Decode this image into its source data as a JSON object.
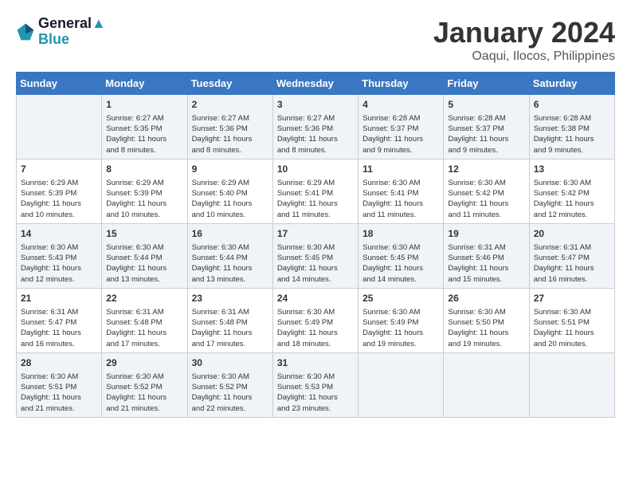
{
  "header": {
    "logo_line1": "General",
    "logo_line2": "Blue",
    "month": "January 2024",
    "location": "Oaqui, Ilocos, Philippines"
  },
  "days_of_week": [
    "Sunday",
    "Monday",
    "Tuesday",
    "Wednesday",
    "Thursday",
    "Friday",
    "Saturday"
  ],
  "weeks": [
    [
      {
        "day": "",
        "info": ""
      },
      {
        "day": "1",
        "info": "Sunrise: 6:27 AM\nSunset: 5:35 PM\nDaylight: 11 hours\nand 8 minutes."
      },
      {
        "day": "2",
        "info": "Sunrise: 6:27 AM\nSunset: 5:36 PM\nDaylight: 11 hours\nand 8 minutes."
      },
      {
        "day": "3",
        "info": "Sunrise: 6:27 AM\nSunset: 5:36 PM\nDaylight: 11 hours\nand 8 minutes."
      },
      {
        "day": "4",
        "info": "Sunrise: 6:28 AM\nSunset: 5:37 PM\nDaylight: 11 hours\nand 9 minutes."
      },
      {
        "day": "5",
        "info": "Sunrise: 6:28 AM\nSunset: 5:37 PM\nDaylight: 11 hours\nand 9 minutes."
      },
      {
        "day": "6",
        "info": "Sunrise: 6:28 AM\nSunset: 5:38 PM\nDaylight: 11 hours\nand 9 minutes."
      }
    ],
    [
      {
        "day": "7",
        "info": "Sunrise: 6:29 AM\nSunset: 5:39 PM\nDaylight: 11 hours\nand 10 minutes."
      },
      {
        "day": "8",
        "info": "Sunrise: 6:29 AM\nSunset: 5:39 PM\nDaylight: 11 hours\nand 10 minutes."
      },
      {
        "day": "9",
        "info": "Sunrise: 6:29 AM\nSunset: 5:40 PM\nDaylight: 11 hours\nand 10 minutes."
      },
      {
        "day": "10",
        "info": "Sunrise: 6:29 AM\nSunset: 5:41 PM\nDaylight: 11 hours\nand 11 minutes."
      },
      {
        "day": "11",
        "info": "Sunrise: 6:30 AM\nSunset: 5:41 PM\nDaylight: 11 hours\nand 11 minutes."
      },
      {
        "day": "12",
        "info": "Sunrise: 6:30 AM\nSunset: 5:42 PM\nDaylight: 11 hours\nand 11 minutes."
      },
      {
        "day": "13",
        "info": "Sunrise: 6:30 AM\nSunset: 5:42 PM\nDaylight: 11 hours\nand 12 minutes."
      }
    ],
    [
      {
        "day": "14",
        "info": "Sunrise: 6:30 AM\nSunset: 5:43 PM\nDaylight: 11 hours\nand 12 minutes."
      },
      {
        "day": "15",
        "info": "Sunrise: 6:30 AM\nSunset: 5:44 PM\nDaylight: 11 hours\nand 13 minutes."
      },
      {
        "day": "16",
        "info": "Sunrise: 6:30 AM\nSunset: 5:44 PM\nDaylight: 11 hours\nand 13 minutes."
      },
      {
        "day": "17",
        "info": "Sunrise: 6:30 AM\nSunset: 5:45 PM\nDaylight: 11 hours\nand 14 minutes."
      },
      {
        "day": "18",
        "info": "Sunrise: 6:30 AM\nSunset: 5:45 PM\nDaylight: 11 hours\nand 14 minutes."
      },
      {
        "day": "19",
        "info": "Sunrise: 6:31 AM\nSunset: 5:46 PM\nDaylight: 11 hours\nand 15 minutes."
      },
      {
        "day": "20",
        "info": "Sunrise: 6:31 AM\nSunset: 5:47 PM\nDaylight: 11 hours\nand 16 minutes."
      }
    ],
    [
      {
        "day": "21",
        "info": "Sunrise: 6:31 AM\nSunset: 5:47 PM\nDaylight: 11 hours\nand 16 minutes."
      },
      {
        "day": "22",
        "info": "Sunrise: 6:31 AM\nSunset: 5:48 PM\nDaylight: 11 hours\nand 17 minutes."
      },
      {
        "day": "23",
        "info": "Sunrise: 6:31 AM\nSunset: 5:48 PM\nDaylight: 11 hours\nand 17 minutes."
      },
      {
        "day": "24",
        "info": "Sunrise: 6:30 AM\nSunset: 5:49 PM\nDaylight: 11 hours\nand 18 minutes."
      },
      {
        "day": "25",
        "info": "Sunrise: 6:30 AM\nSunset: 5:49 PM\nDaylight: 11 hours\nand 19 minutes."
      },
      {
        "day": "26",
        "info": "Sunrise: 6:30 AM\nSunset: 5:50 PM\nDaylight: 11 hours\nand 19 minutes."
      },
      {
        "day": "27",
        "info": "Sunrise: 6:30 AM\nSunset: 5:51 PM\nDaylight: 11 hours\nand 20 minutes."
      }
    ],
    [
      {
        "day": "28",
        "info": "Sunrise: 6:30 AM\nSunset: 5:51 PM\nDaylight: 11 hours\nand 21 minutes."
      },
      {
        "day": "29",
        "info": "Sunrise: 6:30 AM\nSunset: 5:52 PM\nDaylight: 11 hours\nand 21 minutes."
      },
      {
        "day": "30",
        "info": "Sunrise: 6:30 AM\nSunset: 5:52 PM\nDaylight: 11 hours\nand 22 minutes."
      },
      {
        "day": "31",
        "info": "Sunrise: 6:30 AM\nSunset: 5:53 PM\nDaylight: 11 hours\nand 23 minutes."
      },
      {
        "day": "",
        "info": ""
      },
      {
        "day": "",
        "info": ""
      },
      {
        "day": "",
        "info": ""
      }
    ]
  ]
}
